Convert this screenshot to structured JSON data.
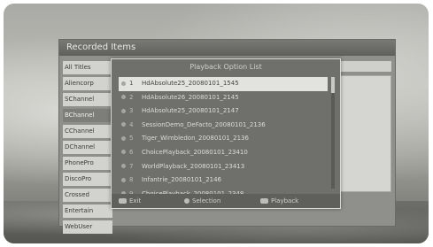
{
  "window": {
    "title": "Recorded Items"
  },
  "sidebar": {
    "items": [
      {
        "label": "All Titles"
      },
      {
        "label": "Aliencorp"
      },
      {
        "label": "SChannel"
      },
      {
        "label": "BChannel"
      },
      {
        "label": "CChannel"
      },
      {
        "label": "DChannel"
      },
      {
        "label": "PhonePro"
      },
      {
        "label": "DiscoPro"
      },
      {
        "label": "Crossed"
      },
      {
        "label": "Entertain"
      },
      {
        "label": "WebUser"
      }
    ]
  },
  "dialog": {
    "title": "Playback Option List",
    "selected_index": 0,
    "items": [
      {
        "num": "1",
        "name": "HdAbsolute25_20080101_1545"
      },
      {
        "num": "2",
        "name": "HdAbsolute26_20080101_2145"
      },
      {
        "num": "3",
        "name": "HdAbsolute25_20080101_2147"
      },
      {
        "num": "4",
        "name": "SessionDemo_DeFacto_20080101_2136"
      },
      {
        "num": "5",
        "name": "Tiger_Wimbledon_20080101_2136"
      },
      {
        "num": "6",
        "name": "ChoicePlayback_20080101_23410"
      },
      {
        "num": "7",
        "name": "WorldPlayback_20080101_23413"
      },
      {
        "num": "8",
        "name": "Infantrie_20080101_2146"
      },
      {
        "num": "9",
        "name": "ChoicePlayback_20080101_2348"
      }
    ],
    "scroll_position": 0.0,
    "footer": {
      "exit_label": "Exit",
      "select_label": "Selection",
      "ok_label": "Playback"
    }
  },
  "colors": {
    "dialog_bg": "#6f6f6c",
    "selection": "#e2e2de",
    "title_bar": "#5f5f5c"
  }
}
